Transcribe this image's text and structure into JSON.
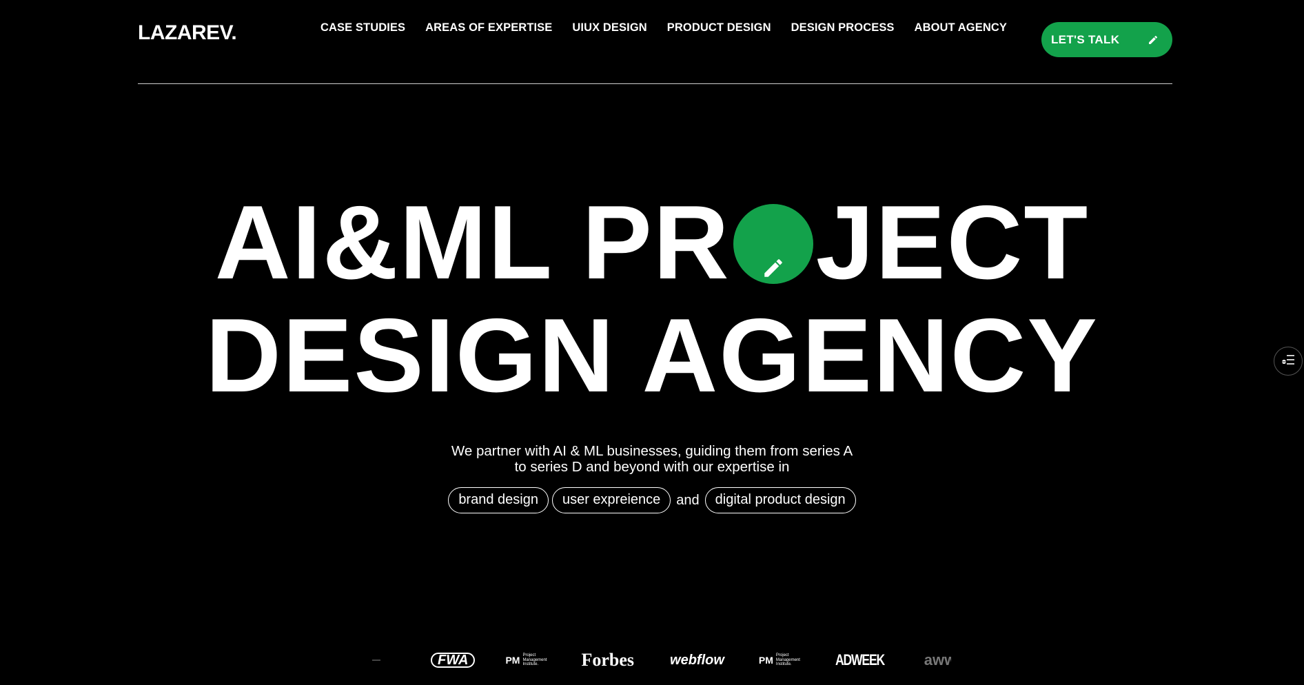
{
  "header": {
    "logo": "LAZAREV.",
    "nav": [
      {
        "label": "CASE STUDIES"
      },
      {
        "label": "AREAS OF EXPERTISE"
      },
      {
        "label": "UIUX DESIGN"
      },
      {
        "label": "PRODUCT DESIGN"
      },
      {
        "label": "DESIGN PROCESS"
      },
      {
        "label": "ABOUT AGENCY"
      }
    ],
    "cta_label": "LET'S TALK",
    "cta_icon": "pencil-icon"
  },
  "hero": {
    "line1_part1": "AI&ML PR",
    "line1_part2": "JECT",
    "line1_o_icon": "pencil-icon",
    "line2": "DESIGN AGENCY"
  },
  "intro": {
    "line1": "We partner with AI & ML businesses, guiding them from series A",
    "line2": "to series D and beyond with our expertise in",
    "chips": [
      "brand design",
      "user expreience",
      "digital product design"
    ],
    "and": "and"
  },
  "side_button_icon": "filter-list-icon",
  "logos": {
    "fwa": "FWA",
    "pmi_mark": "PM",
    "pmi_text_1": "Project",
    "pmi_text_2": "Management",
    "pmi_text_3": "Institute.",
    "forbes": "Forbes",
    "webflow": "webflow",
    "adweek": "ADWEEK",
    "awwwards": "awwwa"
  },
  "colors": {
    "accent": "#13a24b",
    "background": "#000000",
    "text": "#ffffff"
  }
}
